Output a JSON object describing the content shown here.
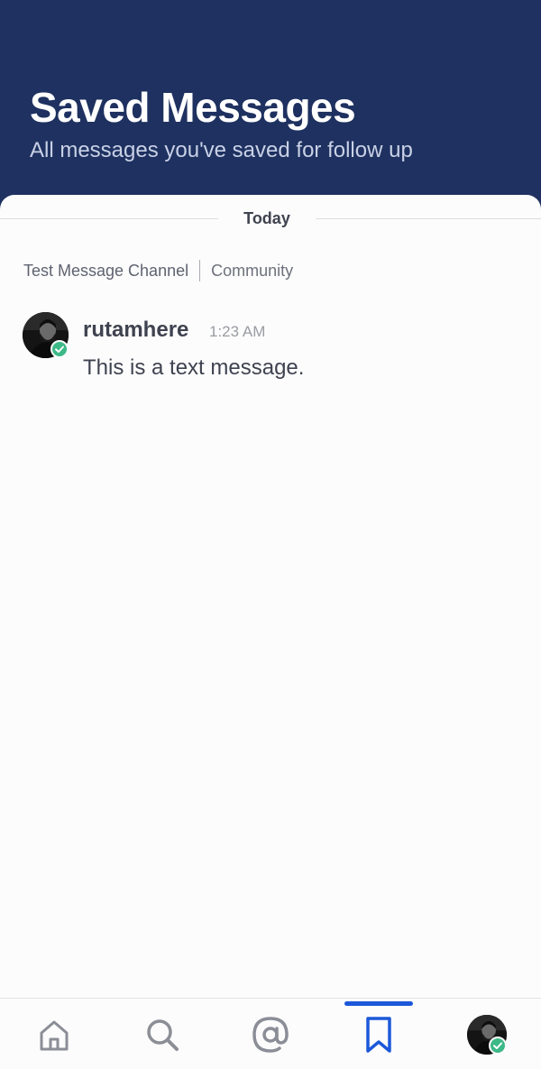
{
  "header": {
    "title": "Saved Messages",
    "subtitle": "All messages you've saved for follow up"
  },
  "date_divider": "Today",
  "post": {
    "channel": "Test Message Channel",
    "team": "Community",
    "username": "rutamhere",
    "time": "1:23 AM",
    "message": "This is a text message.",
    "status": "online"
  },
  "bottom_nav": {
    "items": [
      {
        "id": "home",
        "icon": "home-icon",
        "active": false
      },
      {
        "id": "search",
        "icon": "search-icon",
        "active": false
      },
      {
        "id": "mentions",
        "icon": "at-sign-icon",
        "active": false
      },
      {
        "id": "saved",
        "icon": "bookmark-icon",
        "active": true
      },
      {
        "id": "account",
        "icon": "avatar",
        "active": false
      }
    ]
  },
  "colors": {
    "header_bg": "#1e3160",
    "accent": "#1c58d9",
    "online": "#3db887",
    "text": "#3f4350"
  }
}
